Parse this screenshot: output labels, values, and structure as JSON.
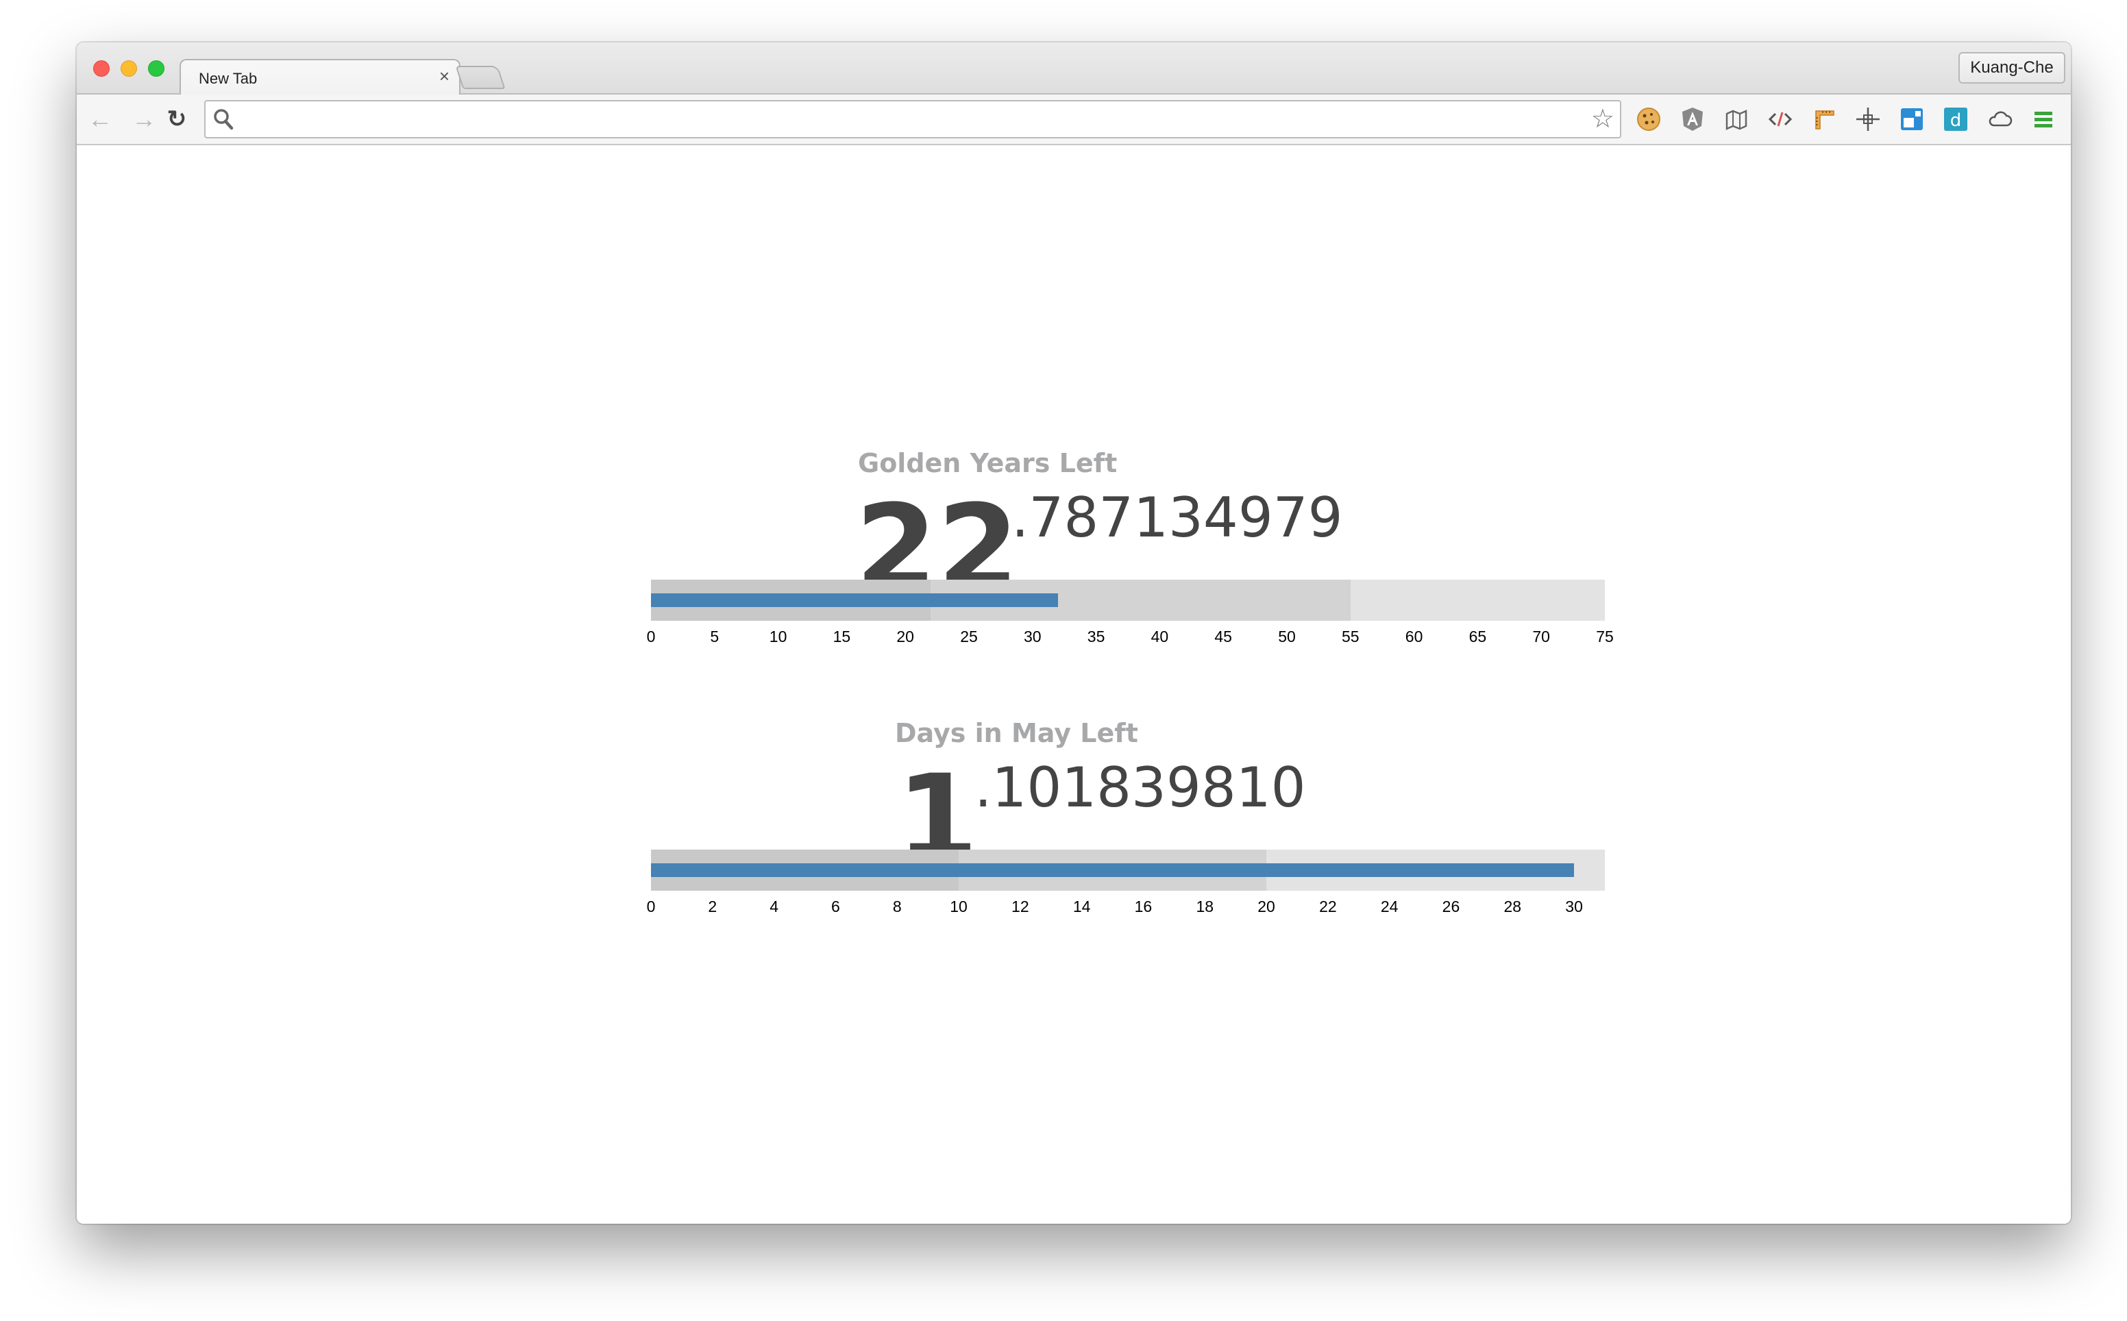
{
  "browser": {
    "tab_title": "New Tab",
    "tab_close": "×",
    "profile_name": "Kuang-Che",
    "address_value": "",
    "address_placeholder": ""
  },
  "extensions": [
    "cookie-icon",
    "angular-icon",
    "map-icon",
    "code-icon",
    "ruler-icon",
    "move-icon",
    "window-icon",
    "d-app-icon",
    "cloud-icon",
    "menu-icon"
  ],
  "colors": {
    "measure": "#4682b4",
    "range_dark": "#c8c8c8",
    "range_mid": "#d3d3d3",
    "range_light": "#e3e3e3",
    "title_gray": "#a7a8aa",
    "number": "#444444"
  },
  "metrics": [
    {
      "title": "Golden Years Left",
      "integer": "22",
      "fraction": ".787134979",
      "chart": {
        "type": "bullet",
        "max": 75,
        "ranges": [
          22,
          55,
          75
        ],
        "measure": 32,
        "ticks": [
          "0",
          "5",
          "10",
          "15",
          "20",
          "25",
          "30",
          "35",
          "40",
          "45",
          "50",
          "55",
          "60",
          "65",
          "70",
          "75"
        ]
      }
    },
    {
      "title": "Days in May Left",
      "integer": "1",
      "fraction": ".101839810",
      "chart": {
        "type": "bullet",
        "max": 31,
        "ranges": [
          10,
          20,
          31
        ],
        "measure": 30,
        "ticks": [
          "0",
          "2",
          "4",
          "6",
          "8",
          "10",
          "12",
          "14",
          "16",
          "18",
          "20",
          "22",
          "24",
          "26",
          "28",
          "30"
        ]
      }
    }
  ],
  "chart_data": [
    {
      "type": "bullet",
      "title": "Golden Years Left",
      "ranges": [
        22,
        55,
        75
      ],
      "measure": 32,
      "xlim": [
        0,
        75
      ],
      "x_ticks": [
        0,
        5,
        10,
        15,
        20,
        25,
        30,
        35,
        40,
        45,
        50,
        55,
        60,
        65,
        70,
        75
      ]
    },
    {
      "type": "bullet",
      "title": "Days in May Left",
      "ranges": [
        10,
        20,
        31
      ],
      "measure": 30,
      "xlim": [
        0,
        31
      ],
      "x_ticks": [
        0,
        2,
        4,
        6,
        8,
        10,
        12,
        14,
        16,
        18,
        20,
        22,
        24,
        26,
        28,
        30
      ]
    }
  ]
}
